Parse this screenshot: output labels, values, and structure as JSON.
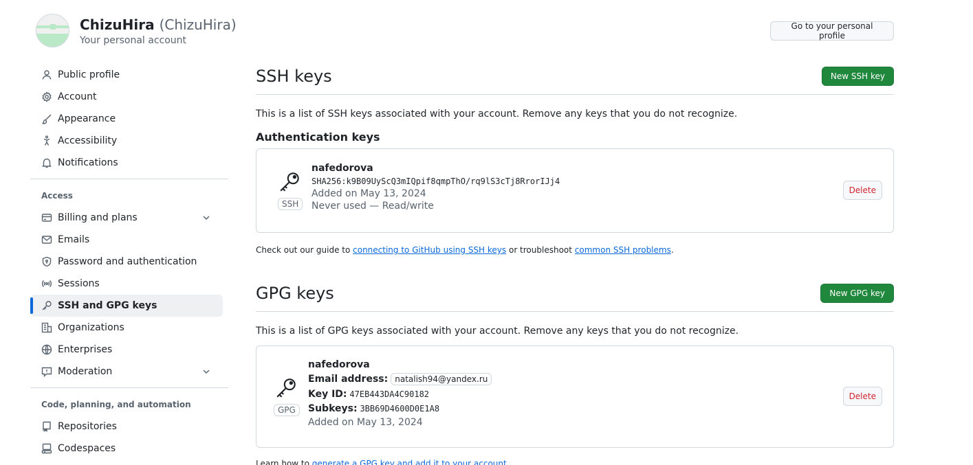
{
  "header": {
    "display_name": "ChizuHira",
    "login": "(ChizuHira)",
    "subtitle": "Your personal account",
    "profile_button": "Go to your personal profile"
  },
  "sidebar": {
    "items_top": [
      {
        "label": "Public profile",
        "icon": "person-icon"
      },
      {
        "label": "Account",
        "icon": "gear-icon"
      },
      {
        "label": "Appearance",
        "icon": "paintbrush-icon"
      },
      {
        "label": "Accessibility",
        "icon": "accessibility-icon"
      },
      {
        "label": "Notifications",
        "icon": "bell-icon"
      }
    ],
    "access_heading": "Access",
    "items_access": [
      {
        "label": "Billing and plans",
        "icon": "credit-card-icon"
      },
      {
        "label": "Emails",
        "icon": "mail-icon"
      },
      {
        "label": "Password and authentication",
        "icon": "shield-lock-icon"
      },
      {
        "label": "Sessions",
        "icon": "broadcast-icon"
      },
      {
        "label": "SSH and GPG keys",
        "icon": "key-icon"
      },
      {
        "label": "Organizations",
        "icon": "organization-icon"
      },
      {
        "label": "Enterprises",
        "icon": "globe-icon"
      },
      {
        "label": "Moderation",
        "icon": "report-icon"
      }
    ],
    "code_heading": "Code, planning, and automation",
    "items_code": [
      {
        "label": "Repositories",
        "icon": "repo-icon"
      },
      {
        "label": "Codespaces",
        "icon": "codespaces-icon"
      }
    ]
  },
  "ssh": {
    "title": "SSH keys",
    "new_button": "New SSH key",
    "description": "This is a list of SSH keys associated with your account. Remove any keys that you do not recognize.",
    "auth_heading": "Authentication keys",
    "key": {
      "name": "nafedorova",
      "fingerprint": "SHA256:k9B09UyScQ3mIQpif8qmpThO/rq9lS3cTj8RrorIJj4",
      "added": "Added on May 13, 2024",
      "usage": "Never used — Read/write",
      "type": "SSH",
      "delete": "Delete"
    },
    "guide_prefix": "Check out our guide to ",
    "guide_link1": "connecting to GitHub using SSH keys",
    "guide_mid": " or troubleshoot ",
    "guide_link2": "common SSH problems",
    "guide_suffix": "."
  },
  "gpg": {
    "title": "GPG keys",
    "new_button": "New GPG key",
    "description": "This is a list of GPG keys associated with your account. Remove any keys that you do not recognize.",
    "key": {
      "name": "nafedorova",
      "email_label": "Email address:",
      "email": "natalish94@yandex.ru",
      "keyid_label": "Key ID:",
      "keyid": "47EB443DA4C90182",
      "subkeys_label": "Subkeys:",
      "subkeys": "3BB69D4600D0E1A8",
      "added": "Added on May 13, 2024",
      "type": "GPG",
      "delete": "Delete"
    },
    "learn_prefix": "Learn how to ",
    "learn_link": "generate a GPG key and add it to your account"
  }
}
